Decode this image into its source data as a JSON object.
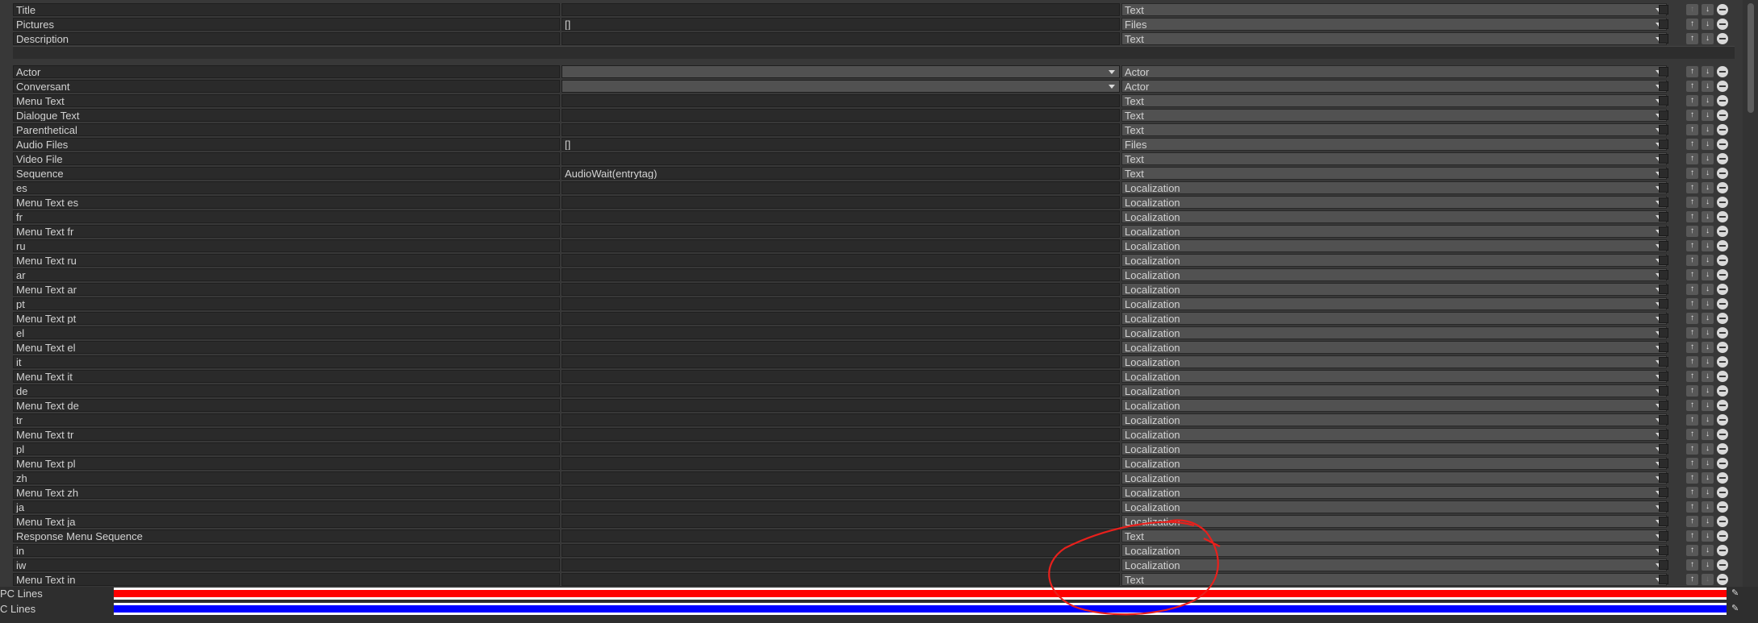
{
  "fields": [
    {
      "name": "Title",
      "value": "",
      "type": "Text"
    },
    {
      "name": "Pictures",
      "value": "[]",
      "type": "Files"
    },
    {
      "name": "Description",
      "value": "",
      "type": "Text"
    },
    {
      "name": "Actor",
      "value": "",
      "type": "Actor",
      "value_dropdown": true
    },
    {
      "name": "Conversant",
      "value": "",
      "type": "Actor",
      "value_dropdown": true
    },
    {
      "name": "Menu Text",
      "value": "",
      "type": "Text"
    },
    {
      "name": "Dialogue Text",
      "value": "",
      "type": "Text"
    },
    {
      "name": "Parenthetical",
      "value": "",
      "type": "Text"
    },
    {
      "name": "Audio Files",
      "value": "[]",
      "type": "Files"
    },
    {
      "name": "Video File",
      "value": "",
      "type": "Text"
    },
    {
      "name": "Sequence",
      "value": "AudioWait(entrytag)",
      "type": "Text"
    },
    {
      "name": "es",
      "value": "",
      "type": "Localization"
    },
    {
      "name": "Menu Text es",
      "value": "",
      "type": "Localization"
    },
    {
      "name": "fr",
      "value": "",
      "type": "Localization"
    },
    {
      "name": "Menu Text fr",
      "value": "",
      "type": "Localization"
    },
    {
      "name": "ru",
      "value": "",
      "type": "Localization"
    },
    {
      "name": "Menu Text ru",
      "value": "",
      "type": "Localization"
    },
    {
      "name": "ar",
      "value": "",
      "type": "Localization"
    },
    {
      "name": "Menu Text ar",
      "value": "",
      "type": "Localization"
    },
    {
      "name": "pt",
      "value": "",
      "type": "Localization"
    },
    {
      "name": "Menu Text pt",
      "value": "",
      "type": "Localization"
    },
    {
      "name": "el",
      "value": "",
      "type": "Localization"
    },
    {
      "name": "Menu Text el",
      "value": "",
      "type": "Localization"
    },
    {
      "name": "it",
      "value": "",
      "type": "Localization"
    },
    {
      "name": "Menu Text it",
      "value": "",
      "type": "Localization"
    },
    {
      "name": "de",
      "value": "",
      "type": "Localization"
    },
    {
      "name": "Menu Text de",
      "value": "",
      "type": "Localization"
    },
    {
      "name": "tr",
      "value": "",
      "type": "Localization"
    },
    {
      "name": "Menu Text tr",
      "value": "",
      "type": "Localization"
    },
    {
      "name": "pl",
      "value": "",
      "type": "Localization"
    },
    {
      "name": "Menu Text pl",
      "value": "",
      "type": "Localization"
    },
    {
      "name": "zh",
      "value": "",
      "type": "Localization"
    },
    {
      "name": "Menu Text zh",
      "value": "",
      "type": "Localization"
    },
    {
      "name": "ja",
      "value": "",
      "type": "Localization"
    },
    {
      "name": "Menu Text ja",
      "value": "",
      "type": "Localization"
    },
    {
      "name": "Response Menu Sequence",
      "value": "",
      "type": "Text"
    },
    {
      "name": "in",
      "value": "",
      "type": "Localization"
    },
    {
      "name": "iw",
      "value": "",
      "type": "Localization"
    },
    {
      "name": "Menu Text in",
      "value": "",
      "type": "Text"
    }
  ],
  "buttons": {
    "up": "↑",
    "down": "↓"
  },
  "icons": {
    "dropdown": "chevron-down-icon",
    "picker": "eyedropper-icon",
    "remove": "minus-circle-icon"
  },
  "bottom_bars": [
    {
      "label": "PC Lines",
      "color": "#ff0000"
    },
    {
      "label": "C Lines",
      "color": "#0000ff"
    }
  ],
  "colors": {
    "annotation": "#e8201c",
    "background": "#383838",
    "field": "#2a2a2a",
    "dropdown": "#515151"
  }
}
